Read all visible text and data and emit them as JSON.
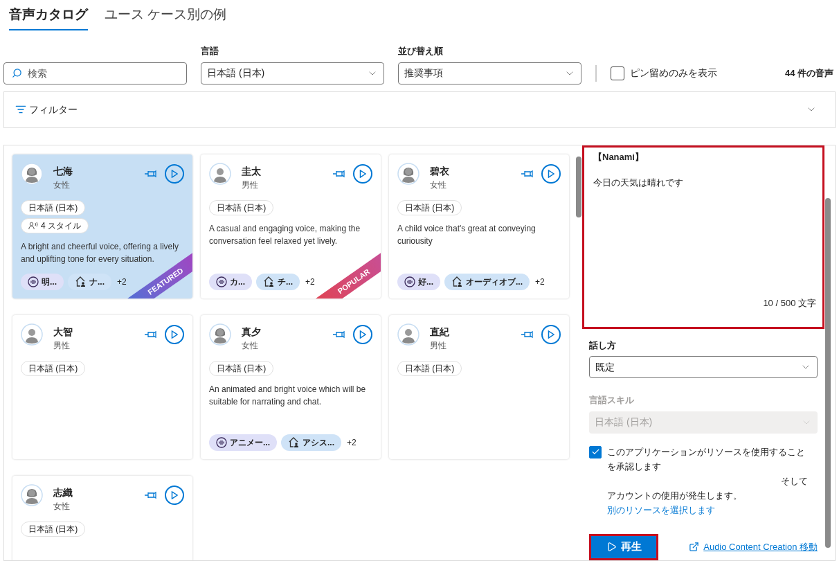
{
  "tabs": [
    {
      "label": "音声カタログ",
      "selected": true
    },
    {
      "label": "ユース ケース別の例",
      "selected": false
    }
  ],
  "search": {
    "placeholder": "検索"
  },
  "language": {
    "label": "言語",
    "value": "日本語 (日本)"
  },
  "sort": {
    "label": "並び替え順",
    "value": "推奨事項"
  },
  "pinned_only": {
    "label": "ピン留めのみを表示",
    "checked": false
  },
  "count": "44 件の音声",
  "filter": {
    "label": "フィルター",
    "expanded": false
  },
  "voices": [
    {
      "name": "七海",
      "gender": "女性",
      "avatar": {
        "kind": "female"
      },
      "selected": true,
      "language": "日本語 (日本)",
      "styles": "4 スタイル",
      "description": "A bright and cheerful voice, offering a lively and uplifting tone for every situation.",
      "tags": [
        {
          "kind": "style",
          "label": "明..."
        },
        {
          "kind": "scenario",
          "label": "ナ..."
        }
      ],
      "more": "+2",
      "ribbon": {
        "kind": "featured",
        "label": "FEATURED"
      }
    },
    {
      "name": "圭太",
      "gender": "男性",
      "avatar": {
        "kind": "male"
      },
      "selected": false,
      "language": "日本語 (日本)",
      "description": "A casual and engaging voice, making the conversation feel relaxed yet lively.",
      "tags": [
        {
          "kind": "style",
          "label": "カ..."
        },
        {
          "kind": "scenario",
          "label": "チ..."
        }
      ],
      "more": "+2",
      "ribbon": {
        "kind": "popular",
        "label": "POPULAR"
      }
    },
    {
      "name": "碧衣",
      "gender": "女性",
      "avatar": {
        "kind": "female"
      },
      "selected": false,
      "language": "日本語 (日本)",
      "description": "A child voice that's great at conveying curiousity",
      "tags": [
        {
          "kind": "style",
          "label": "好..."
        },
        {
          "kind": "scenario",
          "label": "オーディオブ..."
        }
      ],
      "more": "+2"
    },
    {
      "name": "大智",
      "gender": "男性",
      "avatar": {
        "kind": "male"
      },
      "selected": false,
      "language": "日本語 (日本)"
    },
    {
      "name": "真夕",
      "gender": "女性",
      "avatar": {
        "kind": "female"
      },
      "selected": false,
      "language": "日本語 (日本)",
      "description": "An animated and bright voice which will be suitable for narrating and chat.",
      "tags": [
        {
          "kind": "style",
          "label": "アニメー..."
        },
        {
          "kind": "scenario",
          "label": "アシス..."
        }
      ],
      "more": "+2"
    },
    {
      "name": "直紀",
      "gender": "男性",
      "avatar": {
        "kind": "male"
      },
      "selected": false,
      "language": "日本語 (日本)"
    },
    {
      "name": "志織",
      "gender": "女性",
      "avatar": {
        "kind": "female"
      },
      "selected": false,
      "language": "日本語 (日本)"
    }
  ],
  "preview": {
    "title": "【Nanami】",
    "text": "今日の天気は晴れです",
    "counter": "10 / 500 文字",
    "highlighted": true,
    "speaking_style": {
      "label": "話し方",
      "value": "既定",
      "disabled": false
    },
    "language_skill": {
      "label": "言語スキル",
      "value": "日本語 (日本)",
      "disabled": true
    },
    "consent": {
      "checked": true,
      "text": "このアプリケーションがリソースを使用することを承認します",
      "text_2": "そして",
      "text_3": "アカウントの使用が発生します。",
      "link": "別のリソースを選択します"
    },
    "play_button": {
      "label": "再生",
      "highlighted": true
    },
    "acc_link": "Audio Content Creation 移動"
  }
}
